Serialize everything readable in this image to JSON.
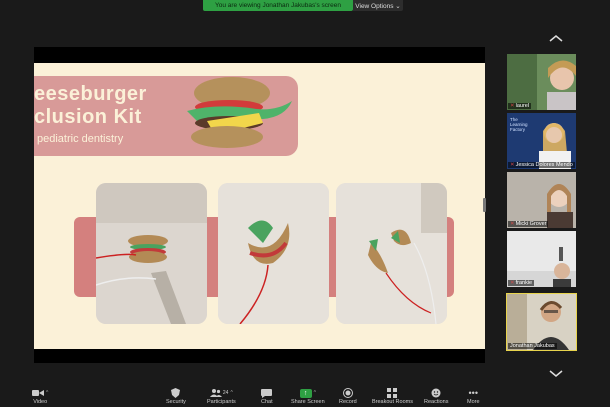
{
  "banner": {
    "text": "You are viewing Jonathan Jakubas's screen",
    "view_options": "View Options ⌄"
  },
  "slide": {
    "title_line1": "eeseburger",
    "title_line2": "clusion Kit",
    "subtitle": "pediatric dentistry"
  },
  "participants": [
    {
      "name": "laurel",
      "muted": true,
      "active": false
    },
    {
      "name": "Jessica Dolores Mendo",
      "muted": true,
      "active": false,
      "logo_text": "The Learning Factory"
    },
    {
      "name": "Micki Grover",
      "muted": true,
      "active": false
    },
    {
      "name": "frankie",
      "muted": true,
      "active": false
    },
    {
      "name": "Jonathan Jakubas",
      "muted": false,
      "active": true
    }
  ],
  "toolbar": {
    "video": "Video",
    "security": "Security",
    "participants": "Participants",
    "participant_count": "24",
    "chat": "Chat",
    "share_screen": "Share Screen",
    "record": "Record",
    "breakout_rooms": "Breakout Rooms",
    "reactions": "Reactions",
    "more": "More"
  },
  "colors": {
    "share_green": "#2ea043",
    "active_speaker": "#e8d44d",
    "slide_bg": "#fbf1d8",
    "accent_pink": "#d89a98"
  },
  "icons": [
    "up-chevron-icon",
    "down-chevron-icon",
    "video-icon",
    "security-shield-icon",
    "participants-icon",
    "chat-icon",
    "share-screen-icon",
    "record-icon",
    "breakout-rooms-icon",
    "reactions-icon",
    "more-icon",
    "muted-mic-icon"
  ]
}
